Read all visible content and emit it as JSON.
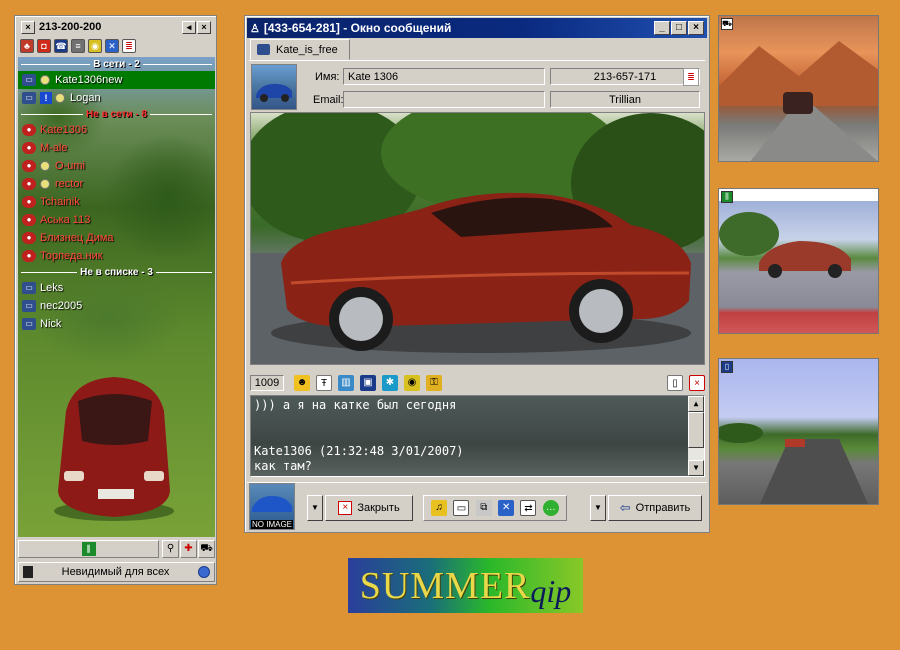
{
  "contact_list": {
    "title": "213-200-200",
    "groups": [
      {
        "label": "В сети - 2",
        "contacts": [
          "Kate1306new",
          "Logan"
        ]
      },
      {
        "label": "Не в сети - 8",
        "contacts": [
          "Kate1306",
          "M-ale",
          "O-umi",
          "rector",
          "Tchainik",
          "Аська 113",
          "Близнец Дима",
          "Торпеда.ник"
        ]
      },
      {
        "label": "Не в списке - 3",
        "contacts": [
          "Leks",
          "nec2005",
          "Nick"
        ]
      }
    ],
    "status_label": "Невидимый для всех"
  },
  "message_window": {
    "title": "[433-654-281] - Окно сообщений",
    "tab_label": "Kate_is_free",
    "name_label": "Имя:",
    "name_value": "Kate  1306",
    "uin_value": "213-657-171",
    "email_label": "Email:",
    "email_value": "",
    "client_value": "Trillian",
    "char_counter": "1009",
    "chat_lines": [
      ")))  а я на катке был сегодня",
      "Kate1306 (21:32:48 3/01/2007)",
      "как там?"
    ],
    "avatar_caption": "NO IMAGE",
    "close_label": "Закрыть",
    "send_label": "Отправить"
  },
  "logo": {
    "word1": "SUMMER",
    "word2": "qip"
  },
  "colors": {
    "desktop": "#dd9333",
    "title_active": "#0a246a",
    "selected_contact": "#007a00",
    "offline_text": "#ff4a3a"
  }
}
